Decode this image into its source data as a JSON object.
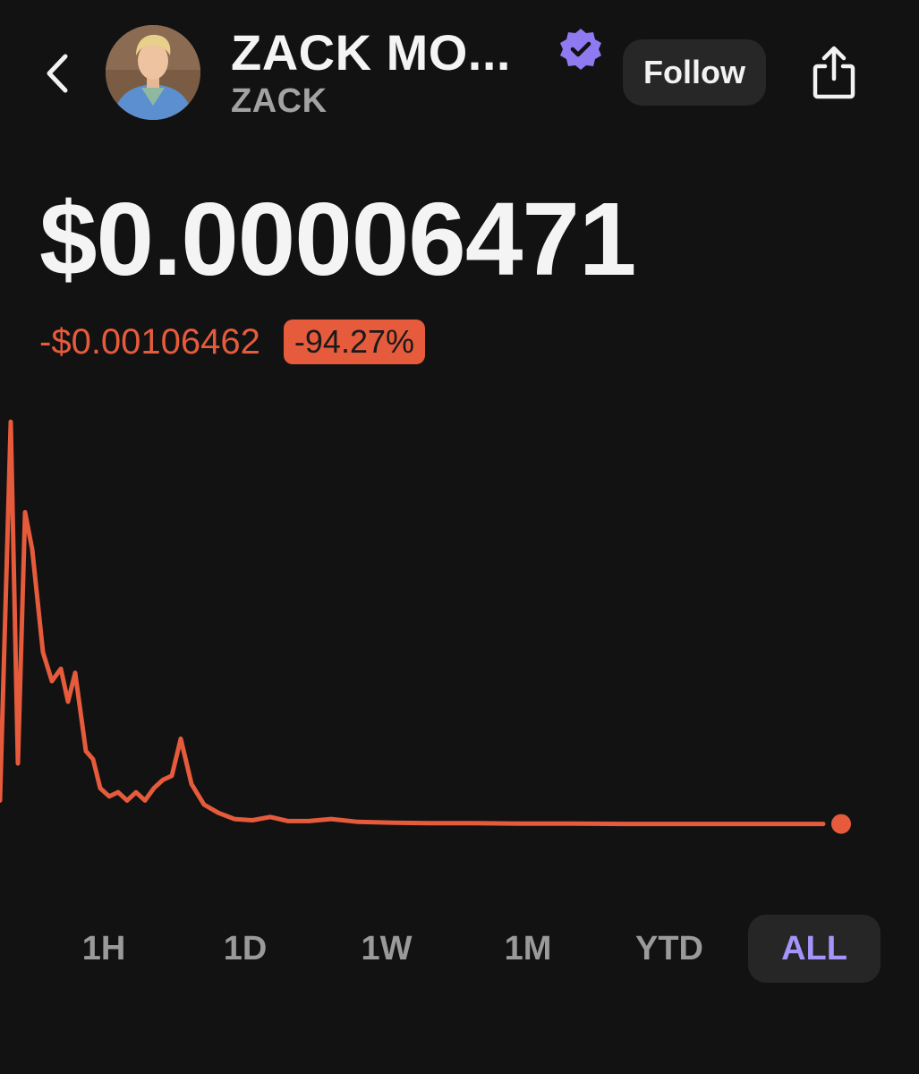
{
  "header": {
    "back_icon": "chevron-left-icon",
    "title": "ZACK MO...",
    "ticker": "ZACK",
    "verified_icon": "verified-badge-icon",
    "follow_label": "Follow",
    "share_icon": "share-icon"
  },
  "price": {
    "current": "$0.00006471",
    "change_abs": "-$0.00106462",
    "change_pct": "-94.27%"
  },
  "colors": {
    "background": "#121212",
    "negative": "#e55b3c",
    "accent": "#a594f9",
    "verified": "#8f7af2"
  },
  "chart_data": {
    "type": "line",
    "title": "",
    "xlabel": "",
    "ylabel": "",
    "grid": false,
    "series": [
      {
        "values": [
          0.06,
          0.98,
          0.15,
          0.76,
          0.67,
          0.42,
          0.35,
          0.38,
          0.3,
          0.37,
          0.18,
          0.16,
          0.09,
          0.07,
          0.08,
          0.06,
          0.08,
          0.06,
          0.09,
          0.11,
          0.12,
          0.21,
          0.1,
          0.05,
          0.03,
          0.015,
          0.012,
          0.02,
          0.01,
          0.01,
          0.015,
          0.008,
          0.006,
          0.005,
          0.005,
          0.004,
          0.004,
          0.003,
          0.003,
          0.003,
          0.003
        ]
      }
    ]
  },
  "ranges": {
    "items": [
      "1H",
      "1D",
      "1W",
      "1M",
      "YTD",
      "ALL"
    ],
    "selected": "ALL"
  }
}
